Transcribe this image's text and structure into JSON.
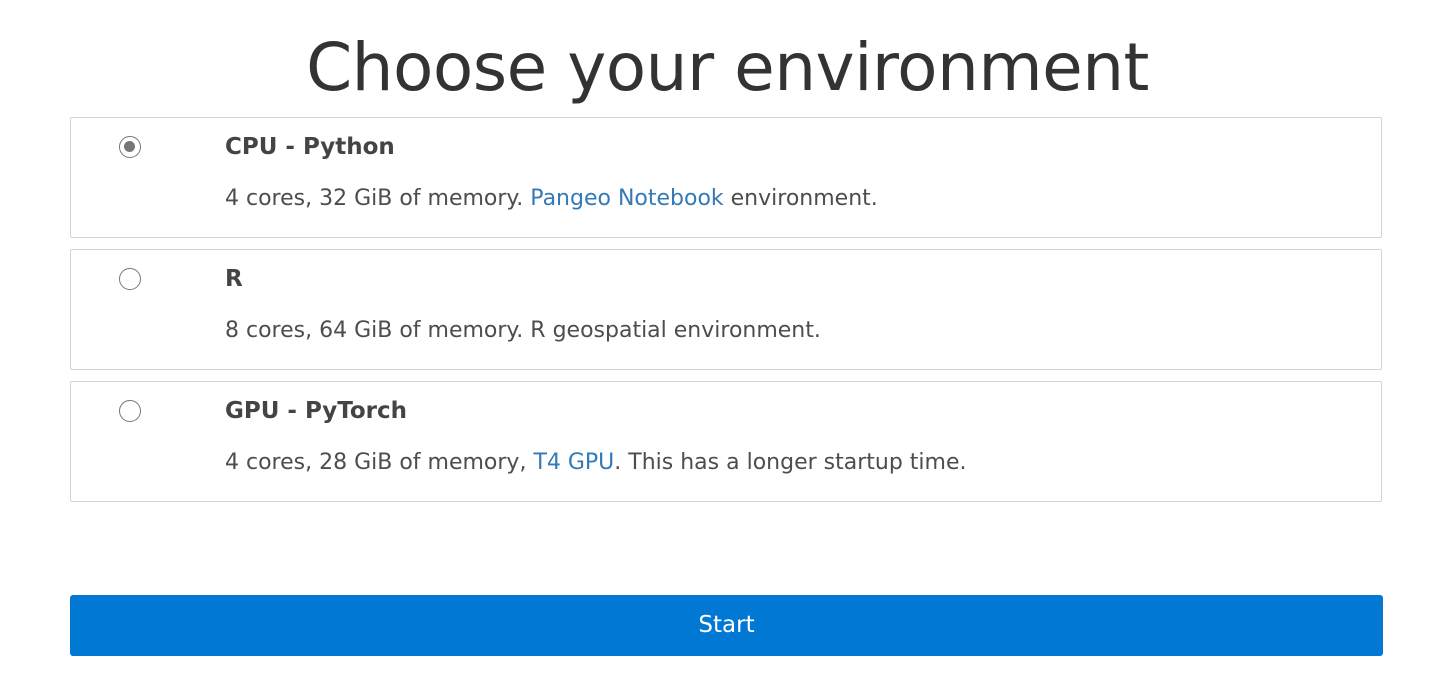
{
  "page": {
    "title": "Choose your environment"
  },
  "options": [
    {
      "title": "CPU - Python",
      "selected": true,
      "desc_before": "4 cores, 32 GiB of memory. ",
      "desc_link": "Pangeo Notebook",
      "desc_after": " environment."
    },
    {
      "title": "R",
      "selected": false,
      "desc_before": "8 cores, 64 GiB of memory. R geospatial environment.",
      "desc_link": "",
      "desc_after": ""
    },
    {
      "title": "GPU - PyTorch",
      "selected": false,
      "desc_before": "4 cores, 28 GiB of memory, ",
      "desc_link": "T4 GPU",
      "desc_after": ". This has a longer startup time."
    }
  ],
  "start_button": {
    "label": "Start"
  },
  "colors": {
    "accent": "#0078d4",
    "link": "#337ab7",
    "border": "#d4d4d4"
  }
}
